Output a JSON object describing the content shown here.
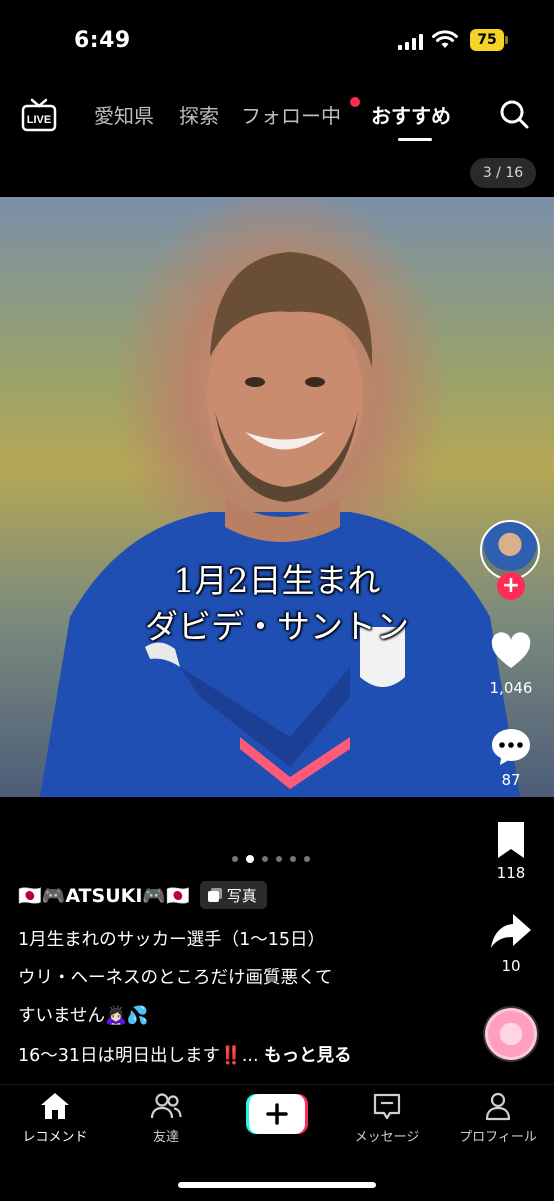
{
  "status_bar": {
    "time": "6:49",
    "battery": "75"
  },
  "top_nav": {
    "tabs": [
      {
        "label": "愛知県"
      },
      {
        "label": "探索"
      },
      {
        "label": "フォロー中"
      },
      {
        "label": "おすすめ",
        "active": true
      }
    ]
  },
  "page_counter": "3 / 16",
  "photo": {
    "overlay_line1": "1月2日生まれ",
    "overlay_line2": "ダビデ・サントン"
  },
  "rail": {
    "likes": "1,046",
    "comments": "87",
    "bookmarks": "118",
    "shares": "10"
  },
  "carousel": {
    "total": 6,
    "active_index": 1
  },
  "caption": {
    "username": "🇯🇵🎮ATSUKI🎮🇯🇵",
    "badge": "写真",
    "line1": "1月生まれのサッカー選手（1〜15日）",
    "line2": "ウリ・ヘーネスのところだけ画質悪くて",
    "line3": "すいません🙇🏻‍♀️💦",
    "line4": "16〜31日は明日出します‼️...",
    "more": "もっと見る"
  },
  "bottom_nav": {
    "home": "レコメンド",
    "friends": "友達",
    "inbox": "メッセージ",
    "profile": "プロフィール"
  },
  "colors": {
    "accent": "#fe2c55",
    "battery": "#f5d328",
    "background": "#000000"
  },
  "icons": [
    "live-icon",
    "search-icon",
    "heart-icon",
    "comment-icon",
    "bookmark-icon",
    "share-icon",
    "home-icon",
    "friends-icon",
    "plus-icon",
    "inbox-icon",
    "profile-icon"
  ]
}
